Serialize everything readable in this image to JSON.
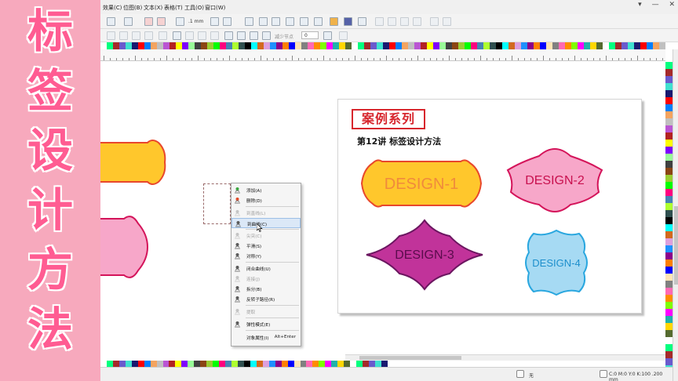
{
  "title_panel": {
    "chars": [
      "标",
      "签",
      "设",
      "计",
      "方",
      "法"
    ]
  },
  "menubar": {
    "items": [
      "效果(C)",
      "位图(B)",
      "文本(X)",
      "表格(T)",
      "工具(O)",
      "窗口(W)"
    ],
    "window_controls": [
      "▾",
      "—",
      "✕"
    ]
  },
  "toolbar": {
    "nudge_value": ".1 mm",
    "node_field_label": "减少节点",
    "node_field_value": "0"
  },
  "document": {
    "series_badge": "案例系列",
    "lesson_title": "第12讲 标签设计方法",
    "designs": [
      {
        "label": "DESIGN-1",
        "fill": "#ffc72c",
        "stroke": "#e8472c",
        "text_color": "#f08a3c"
      },
      {
        "label": "DESIGN-2",
        "fill": "#f7a7c9",
        "stroke": "#d4145a",
        "text_color": "#c8104e"
      },
      {
        "label": "DESIGN-3",
        "fill": "#c1339a",
        "stroke": "#6b1660",
        "text_color": "#5a0c4c"
      },
      {
        "label": "DESIGN-4",
        "fill": "#a6daf3",
        "stroke": "#2aa7df",
        "text_color": "#1d8fcc"
      }
    ]
  },
  "context_menu": {
    "items": [
      {
        "label": "添加(A)",
        "icon": "add-node-icon",
        "disabled": false
      },
      {
        "label": "删除(D)",
        "icon": "delete-node-icon",
        "disabled": false
      },
      {
        "label": "到直线(L)",
        "icon": "to-line-icon",
        "disabled": true
      },
      {
        "label": "到曲线(C)",
        "icon": "to-curve-icon",
        "disabled": false,
        "hover": true
      },
      {
        "label": "尖突(C)",
        "icon": "cusp-icon",
        "disabled": true
      },
      {
        "label": "平滑(S)",
        "icon": "smooth-icon",
        "disabled": false
      },
      {
        "label": "对称(Y)",
        "icon": "symmetric-icon",
        "disabled": false
      },
      {
        "label": "闭合曲线(U)",
        "icon": "close-curve-icon",
        "disabled": false
      },
      {
        "label": "连接(J)",
        "icon": "join-icon",
        "disabled": true
      },
      {
        "label": "拆分(B)",
        "icon": "break-icon",
        "disabled": false
      },
      {
        "label": "反转子路径(R)",
        "icon": "reverse-path-icon",
        "disabled": false
      },
      {
        "label": "提取",
        "icon": "extract-icon",
        "disabled": true
      },
      {
        "label": "弹性模式(E)",
        "icon": "elastic-mode-icon",
        "disabled": false
      },
      {
        "label": "对象属性(I)",
        "icon": "",
        "disabled": false,
        "shortcut": "Alt+Enter"
      }
    ]
  },
  "statusbar": {
    "fill_label": "无",
    "color_readout": "C:0 M:0 Y:0 K:100  .200 mm"
  },
  "colors": {
    "title_panel_bg": "#f7a9bd",
    "title_text": "#ff5c92",
    "accent_red": "#d7262d"
  }
}
